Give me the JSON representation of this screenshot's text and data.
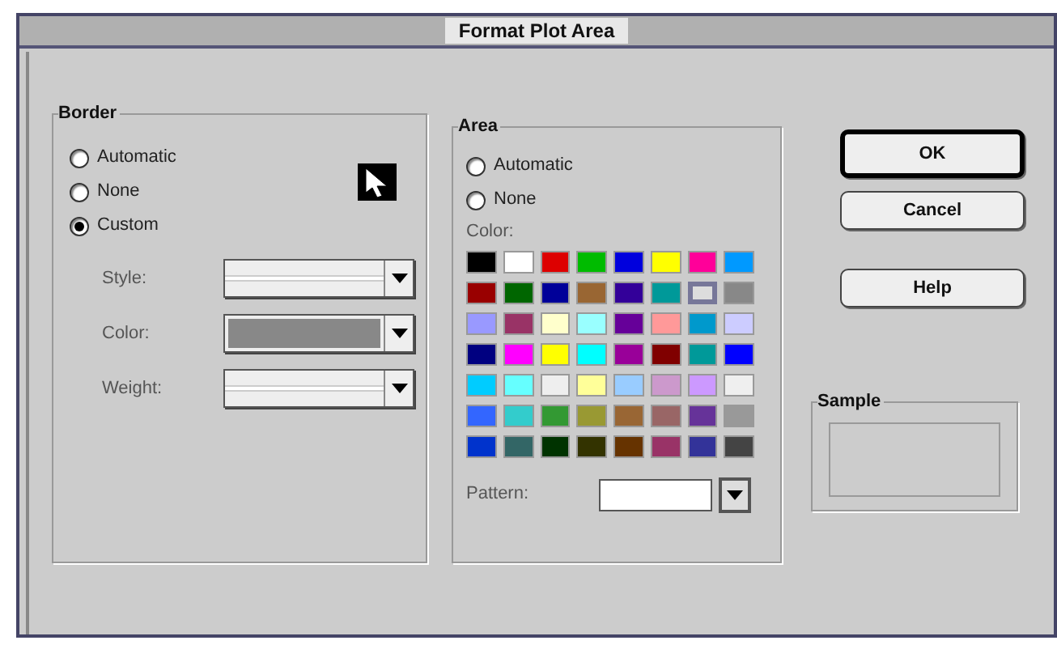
{
  "window": {
    "title": "Format Plot Area"
  },
  "border": {
    "title": "Border",
    "options": [
      {
        "label": "Automatic",
        "selected": false
      },
      {
        "label": "None",
        "selected": false
      },
      {
        "label": "Custom",
        "selected": true
      }
    ],
    "fields": [
      {
        "label": "Style:",
        "kind": "line"
      },
      {
        "label": "Color:",
        "kind": "color",
        "color": "#888888"
      },
      {
        "label": "Weight:",
        "kind": "line"
      }
    ]
  },
  "area": {
    "title": "Area",
    "options": [
      {
        "label": "Automatic",
        "selected": false
      },
      {
        "label": "None",
        "selected": false
      }
    ],
    "color_label": "Color:",
    "swatches": [
      {
        "color": "#000000",
        "selected": false
      },
      {
        "color": "#ffffff",
        "selected": false
      },
      {
        "color": "#dd0000",
        "selected": false
      },
      {
        "color": "#00bb00",
        "selected": false
      },
      {
        "color": "#0000dd",
        "selected": false
      },
      {
        "color": "#ffff00",
        "selected": false
      },
      {
        "color": "#ff0099",
        "selected": false
      },
      {
        "color": "#0099ff",
        "selected": false
      },
      {
        "color": "#990000",
        "selected": false
      },
      {
        "color": "#006600",
        "selected": false
      },
      {
        "color": "#000099",
        "selected": false
      },
      {
        "color": "#996633",
        "selected": false
      },
      {
        "color": "#330099",
        "selected": false
      },
      {
        "color": "#009999",
        "selected": false
      },
      {
        "color": "#dddddd",
        "selected": true
      },
      {
        "color": "#888888",
        "selected": false
      },
      {
        "color": "#9999ff",
        "selected": false
      },
      {
        "color": "#993366",
        "selected": false
      },
      {
        "color": "#ffffcc",
        "selected": false
      },
      {
        "color": "#99ffff",
        "selected": false
      },
      {
        "color": "#660099",
        "selected": false
      },
      {
        "color": "#ff9999",
        "selected": false
      },
      {
        "color": "#0099cc",
        "selected": false
      },
      {
        "color": "#ccccff",
        "selected": false
      },
      {
        "color": "#000080",
        "selected": false
      },
      {
        "color": "#ff00ff",
        "selected": false
      },
      {
        "color": "#ffff00",
        "selected": false
      },
      {
        "color": "#00ffff",
        "selected": false
      },
      {
        "color": "#990099",
        "selected": false
      },
      {
        "color": "#800000",
        "selected": false
      },
      {
        "color": "#009999",
        "selected": false
      },
      {
        "color": "#0000ff",
        "selected": false
      },
      {
        "color": "#00ccff",
        "selected": false
      },
      {
        "color": "#66ffff",
        "selected": false
      },
      {
        "color": "#eeeeee",
        "selected": false
      },
      {
        "color": "#ffff99",
        "selected": false
      },
      {
        "color": "#99ccff",
        "selected": false
      },
      {
        "color": "#cc99cc",
        "selected": false
      },
      {
        "color": "#cc99ff",
        "selected": false
      },
      {
        "color": "#efefef",
        "selected": false
      },
      {
        "color": "#3366ff",
        "selected": false
      },
      {
        "color": "#33cccc",
        "selected": false
      },
      {
        "color": "#339933",
        "selected": false
      },
      {
        "color": "#999933",
        "selected": false
      },
      {
        "color": "#996634",
        "selected": false
      },
      {
        "color": "#996666",
        "selected": false
      },
      {
        "color": "#663399",
        "selected": false
      },
      {
        "color": "#999999",
        "selected": false
      },
      {
        "color": "#0033cc",
        "selected": false
      },
      {
        "color": "#336666",
        "selected": false
      },
      {
        "color": "#003300",
        "selected": false
      },
      {
        "color": "#333300",
        "selected": false
      },
      {
        "color": "#663300",
        "selected": false
      },
      {
        "color": "#993367",
        "selected": false
      },
      {
        "color": "#333399",
        "selected": false
      },
      {
        "color": "#444444",
        "selected": false
      }
    ],
    "pattern_label": "Pattern:"
  },
  "buttons": [
    {
      "label": "OK",
      "default": true
    },
    {
      "label": "Cancel",
      "default": false
    },
    {
      "label": "Help",
      "default": false
    }
  ],
  "sample": {
    "title": "Sample"
  }
}
